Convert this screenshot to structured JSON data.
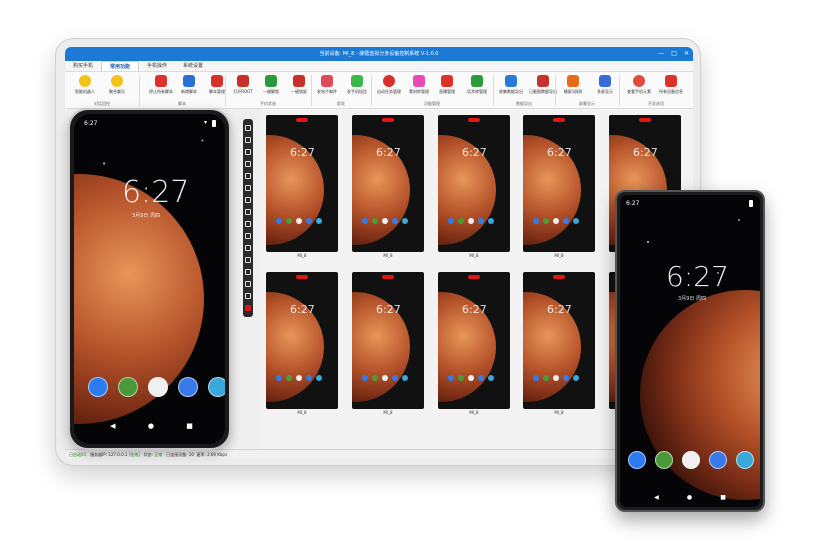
{
  "window": {
    "title": "当前设备: MI_8 - 薛霆虚拟分身设备控制系统 V-1.0.0",
    "controls": [
      "—",
      "□",
      "✕"
    ]
  },
  "menu": [
    {
      "label": "购买手机",
      "active": false
    },
    {
      "label": "常用功能",
      "active": true
    },
    {
      "label": "手机操作",
      "active": false
    },
    {
      "label": "系统设置",
      "active": false
    }
  ],
  "ribbon": {
    "buttons": [
      {
        "label": "智能机器人",
        "color": "#f3c21b",
        "shape": "round",
        "icon": "robot-icon"
      },
      {
        "label": "聚合聊天",
        "color": "#f3c21b",
        "shape": "round",
        "icon": "chat-icon"
      },
      {
        "label": "停止所有脚本",
        "color": "#e0302a",
        "shape": "square",
        "icon": "stop-icon"
      },
      {
        "label": "新增脚本",
        "color": "#2a6fd8",
        "shape": "square",
        "icon": "edit-icon"
      },
      {
        "label": "脚本管理",
        "color": "#d8302a",
        "shape": "square",
        "icon": "script-icon"
      },
      {
        "label": "打开ROOT",
        "color": "#c8302a",
        "shape": "square",
        "icon": "root-icon"
      },
      {
        "label": "一键解锁",
        "color": "#2a9a3a",
        "shape": "square",
        "icon": "unlock-icon"
      },
      {
        "label": "一键锁屏",
        "color": "#c8302a",
        "shape": "square",
        "icon": "lock-icon"
      },
      {
        "label": "发电子邮件",
        "color": "#e04a5a",
        "shape": "square",
        "icon": "mail-icon"
      },
      {
        "label": "发手机短信",
        "color": "#3ab84a",
        "shape": "square",
        "icon": "sms-icon"
      },
      {
        "label": "自动任务管理",
        "color": "#d8302a",
        "shape": "round",
        "icon": "clock-icon"
      },
      {
        "label": "素材库管理",
        "color": "#e84ab0",
        "shape": "square",
        "icon": "gallery-icon"
      },
      {
        "label": "直播管理",
        "color": "#e0302a",
        "shape": "square",
        "icon": "live-icon"
      },
      {
        "label": "话术库管理",
        "color": "#2a9a3a",
        "shape": "square",
        "icon": "speech-icon"
      },
      {
        "label": "收集数据导出",
        "color": "#2a7ad8",
        "shape": "square",
        "icon": "export-icon"
      },
      {
        "label": "已截图数据导出",
        "color": "#c8302a",
        "shape": "square",
        "icon": "screenshot-icon"
      },
      {
        "label": "横屏1屏屏",
        "color": "#e86a1a",
        "shape": "square",
        "icon": "landscape-icon"
      },
      {
        "label": "多屏显示",
        "color": "#3a6ad8",
        "shape": "square",
        "icon": "multiscreen-icon"
      },
      {
        "label": "查看手机元素",
        "color": "#e04a3a",
        "shape": "round",
        "icon": "share-icon"
      },
      {
        "label": "所有设备信息",
        "color": "#e0302a",
        "shape": "square",
        "icon": "devices-icon"
      }
    ],
    "groups": [
      "对话回控",
      "脚本",
      "手机状态",
      "群发",
      "功能管理",
      "数据导出",
      "屏幕显示",
      "开发选项"
    ]
  },
  "phone_main": {
    "status_time": "6:27",
    "lock_time": "6:27",
    "lock_date": "3月9日 周四",
    "dock_colors": [
      "#2b7cf0",
      "#4a9a3a",
      "#f0f0f0",
      "#3a7ae8",
      "#3aa8d8"
    ]
  },
  "grid": {
    "label": "MI_8",
    "mini_time": "6:27",
    "dock_colors": [
      "#2b7cf0",
      "#4a9a3a",
      "#f0f0f0",
      "#3a7ae8",
      "#3aa8d8"
    ],
    "count": 10
  },
  "statusbar": {
    "connect": "已启动V1",
    "server_label": "服务器IP:",
    "server_ip": "127.0.0.1",
    "server_status": "[在线]",
    "state_label": "状态:",
    "state_value": "正常",
    "devices_label": "已连接设备:",
    "devices_value": "10",
    "speed_label": "速率:",
    "speed_value": "2.69 Kbps"
  },
  "phone_right": {
    "status_time": "6:27",
    "lock_time": "6:27",
    "lock_date": "3月9日 周四",
    "dock_colors": [
      "#2b7cf0",
      "#4a9a3a",
      "#f0f0f0",
      "#3a7ae8",
      "#3aa8d8"
    ]
  },
  "colors": {
    "accent": "#1b7ad6",
    "badge": "#e01515"
  }
}
